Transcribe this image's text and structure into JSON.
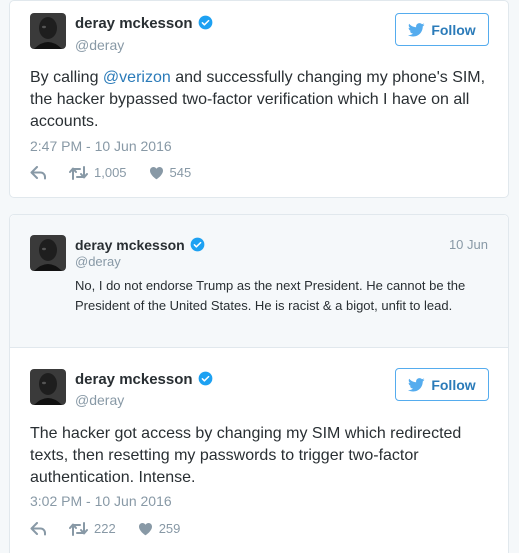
{
  "tweet1": {
    "display_name": "deray mckesson",
    "handle": "@deray",
    "follow_label": "Follow",
    "text_before": "By calling ",
    "mention": "@verizon",
    "text_after": " and successfully changing my phone's SIM, the hacker bypassed two-factor verification which I have on all accounts.",
    "timestamp": "2:47 PM - 10 Jun 2016",
    "retweets": "1,005",
    "likes": "545"
  },
  "quoted": {
    "display_name": "deray mckesson",
    "handle": "@deray",
    "date": "10 Jun",
    "text": "No, I do not endorse Trump as the next President. He cannot be the President of the United States. He is racist & a bigot, unfit to lead."
  },
  "tweet2": {
    "display_name": "deray mckesson",
    "handle": "@deray",
    "follow_label": "Follow",
    "text": "The hacker got access by changing my SIM which redirected texts, then resetting my passwords to trigger two-factor authentication. Intense.",
    "timestamp": "3:02 PM - 10 Jun 2016",
    "retweets": "222",
    "likes": "259"
  },
  "colors": {
    "link": "#2b7bb9",
    "verified": "#1da1f2",
    "muted": "#8899a6",
    "border": "#e1e8ed"
  },
  "icons": [
    "verified-badge-icon",
    "twitter-bird-icon",
    "reply-icon",
    "retweet-icon",
    "heart-icon"
  ]
}
